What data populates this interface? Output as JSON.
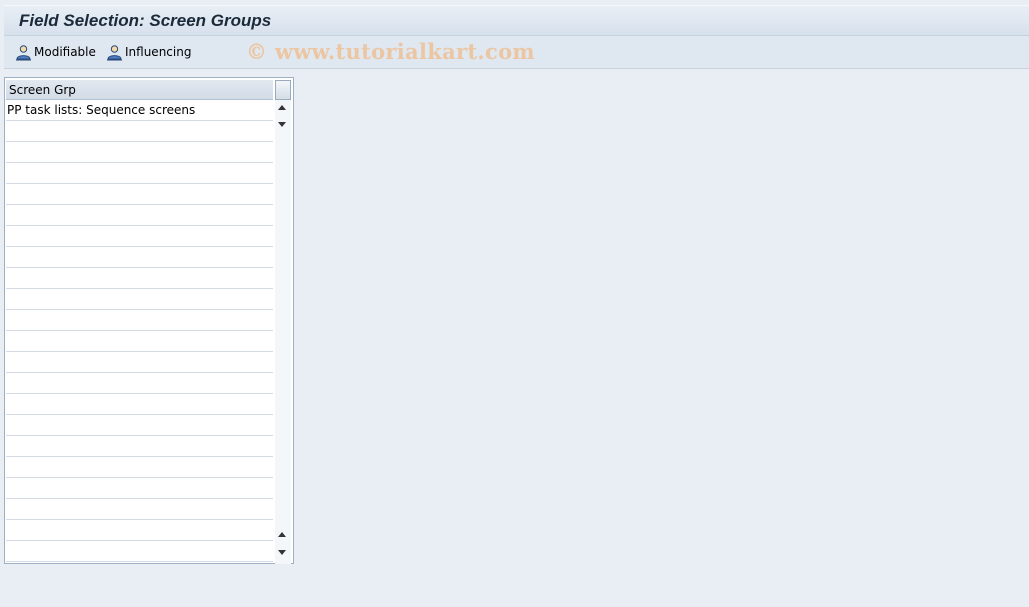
{
  "window": {
    "title": "Field Selection: Screen Groups"
  },
  "toolbar": {
    "modifiable_label": "Modifiable",
    "influencing_label": "Influencing",
    "watermark": "© www.tutorialkart.com"
  },
  "table": {
    "column_header": "Screen Grp",
    "rows": [
      "PP task lists: Sequence screens"
    ]
  },
  "icons": {
    "modifiable": "user-field-icon",
    "influencing": "user-field-icon",
    "scroll_up": "arrow-up-icon",
    "scroll_down": "arrow-down-icon"
  },
  "colors": {
    "background": "#e9eef4",
    "title_bar": "#dbe4ee",
    "toolbar": "#dfe7f0",
    "watermark": "#ecc6a2"
  }
}
